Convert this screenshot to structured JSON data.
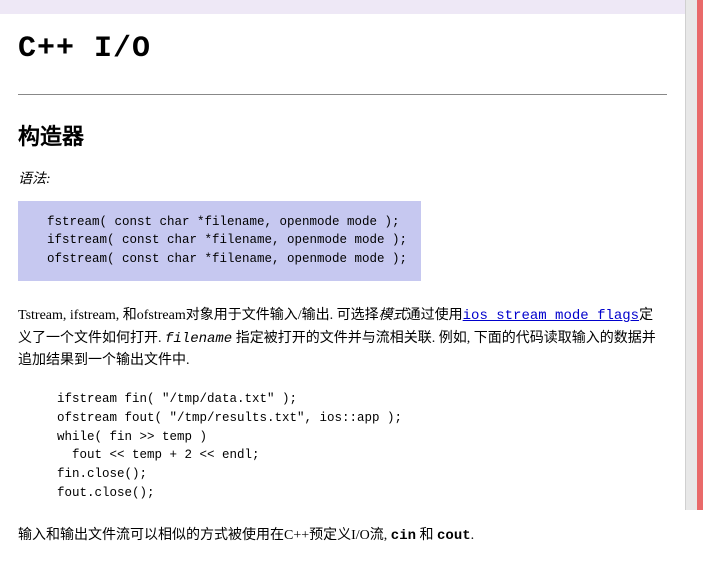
{
  "breadcrumb": {
    "site": "",
    "section": "",
    "sep": "›"
  },
  "title": "C++ I/O",
  "h2": "构造器",
  "syntax_label": "语法:",
  "code_syntax": "  fstream( const char *filename, openmode mode );\n  ifstream( const char *filename, openmode mode );\n  ofstream( const char *filename, openmode mode );",
  "para1": {
    "seg1": "Tstream, ifstream, 和ofstream对象用于文件输入/输出. 可选择",
    "seg2_italic": "模式",
    "seg3": "通过使用",
    "link_text": "ios stream mode flags",
    "seg4": "定义了一个文件如何打开. ",
    "seg5_italic": "filename",
    "seg6": " 指定被打开的文件并与流相关联. 例如, 下面的代码读取输入的数据并追加结果到一个输出文件中."
  },
  "code_example": "  ifstream fin( \"/tmp/data.txt\" );\n  ofstream fout( \"/tmp/results.txt\", ios::app );\n  while( fin >> temp )\n    fout << temp + 2 << endl;\n  fin.close();\n  fout.close();",
  "para2": {
    "seg1": "输入和输出文件流可以相似的方式被使用在C++预定义I/O流, ",
    "cin": "cin",
    "and": " 和 ",
    "cout": "cout",
    "end": "."
  }
}
